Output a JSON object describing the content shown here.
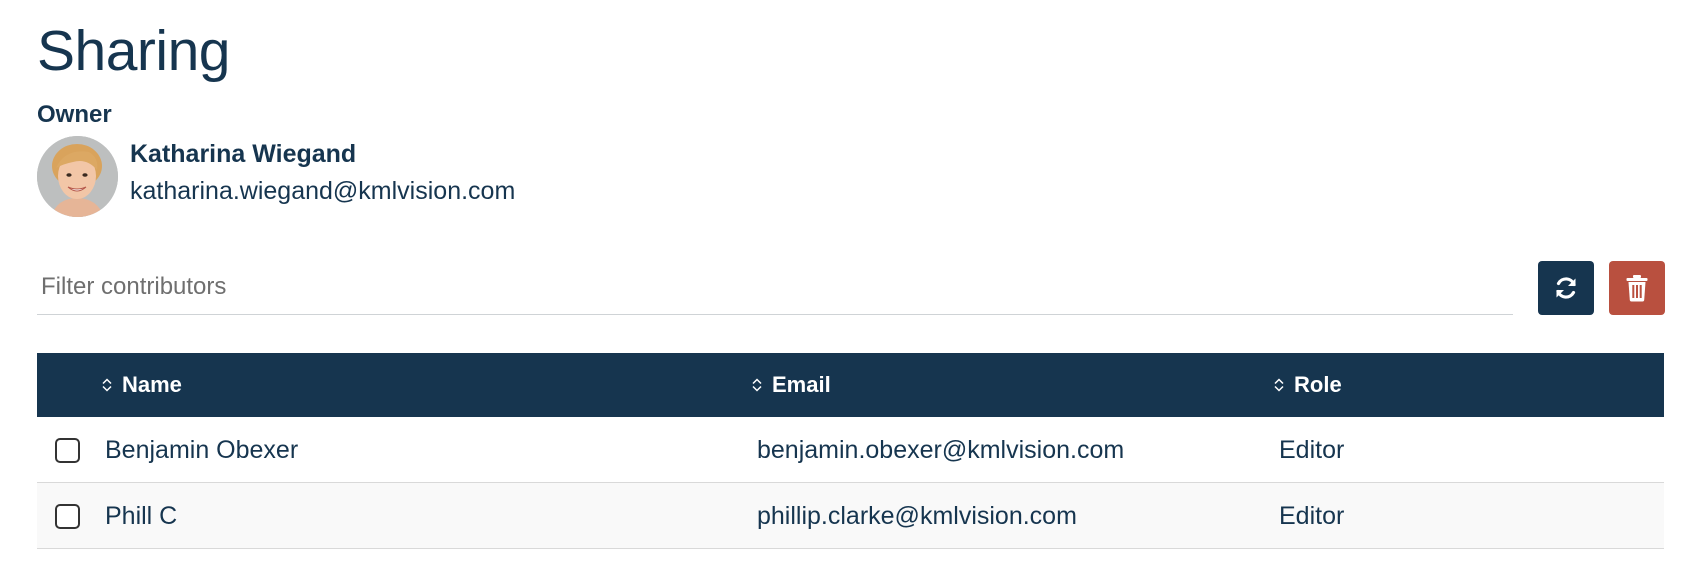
{
  "page": {
    "title": "Sharing"
  },
  "owner": {
    "label": "Owner",
    "name": "Katharina Wiegand",
    "email": "katharina.wiegand@kmlvision.com"
  },
  "filter": {
    "placeholder": "Filter contributors",
    "value": ""
  },
  "toolbar": {
    "refresh_icon": "refresh-icon",
    "delete_icon": "trash-icon",
    "refresh_color": "#16354f",
    "delete_color": "#b9503f"
  },
  "table": {
    "columns": [
      {
        "label": "Name",
        "sortable": true
      },
      {
        "label": "Email",
        "sortable": true
      },
      {
        "label": "Role",
        "sortable": true
      }
    ],
    "rows": [
      {
        "name": "Benjamin Obexer",
        "email": "benjamin.obexer@kmlvision.com",
        "role": "Editor",
        "checked": false
      },
      {
        "name": "Phill C",
        "email": "phillip.clarke@kmlvision.com",
        "role": "Editor",
        "checked": false
      }
    ],
    "header_color": "#16354f"
  }
}
